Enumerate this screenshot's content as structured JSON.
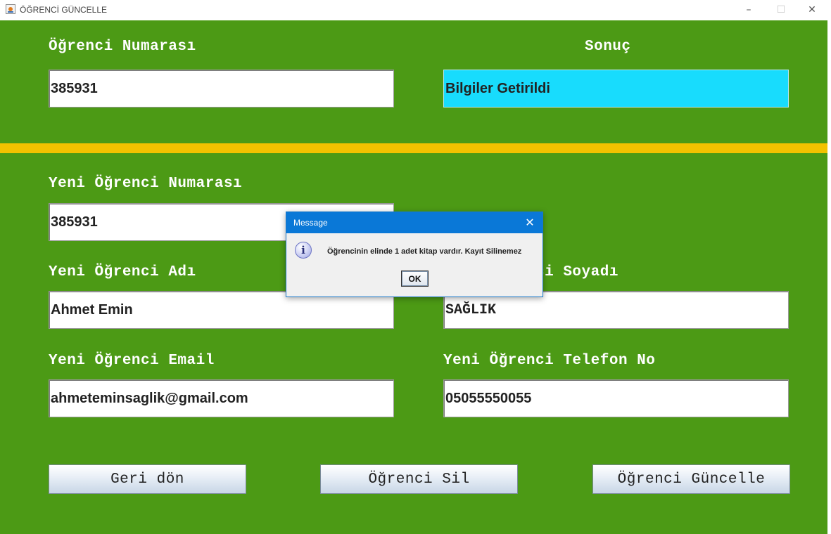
{
  "window": {
    "title": "ÖĞRENCİ GÜNCELLE",
    "minimize_glyph": "–",
    "maximize_glyph": "☐",
    "close_glyph": "✕",
    "icon": "java-app-icon"
  },
  "colors": {
    "background": "#4c9a15",
    "divider": "#f2c200",
    "result_field": "#18dcfd",
    "label_text": "#ffffff"
  },
  "search": {
    "student_number_label": "Öğrenci Numarası",
    "student_number_value": "385931",
    "result_label": "Sonuç",
    "result_value": "Bilgiler Getirildi"
  },
  "form": {
    "new_number_label": "Yeni Öğrenci Numarası",
    "new_number_value": "385931",
    "new_name_label": "Yeni Öğrenci Adı",
    "new_name_value": "Ahmet Emin",
    "new_surname_label": "Yeni Öğrenci Soyadı",
    "new_surname_value": "SAĞLIK",
    "new_email_label": "Yeni Öğrenci Email",
    "new_email_value": "ahmeteminsaglik@gmail.com",
    "new_phone_label": "Yeni Öğrenci Telefon No",
    "new_phone_value": "05055550055"
  },
  "buttons": {
    "back": "Geri dön",
    "delete": "Öğrenci Sil",
    "update": "Öğrenci Güncelle"
  },
  "dialog": {
    "title": "Message",
    "close_glyph": "✕",
    "icon": "information-icon",
    "icon_glyph": "i",
    "message": "Öğrencinin elinde 1 adet kitap vardır. Kayıt Silinemez",
    "ok_label": "OK"
  }
}
